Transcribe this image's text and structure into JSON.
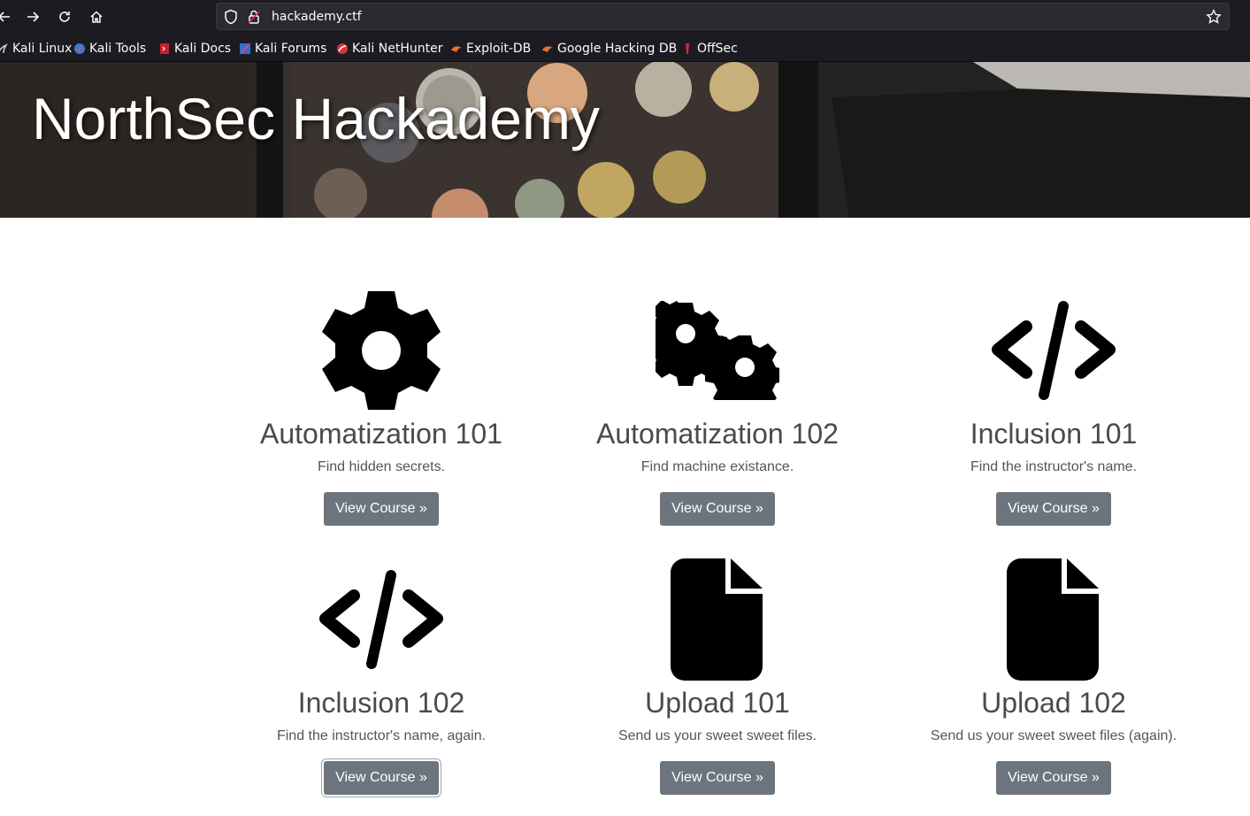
{
  "browser": {
    "url": "hackademy.ctf",
    "bookmarks": [
      {
        "label": "Kali Linux",
        "icon": "kali-dragon-icon"
      },
      {
        "label": "Kali Tools",
        "icon": "kali-tools-icon"
      },
      {
        "label": "Kali Docs",
        "icon": "kali-docs-icon"
      },
      {
        "label": "Kali Forums",
        "icon": "kali-forums-icon"
      },
      {
        "label": "Kali NetHunter",
        "icon": "nethunter-icon"
      },
      {
        "label": "Exploit-DB",
        "icon": "exploit-db-icon"
      },
      {
        "label": "Google Hacking DB",
        "icon": "ghdb-icon"
      },
      {
        "label": "OffSec",
        "icon": "offsec-icon"
      }
    ]
  },
  "hero": {
    "title": "NorthSec Hackademy"
  },
  "courses": [
    {
      "title": "Automatization 101",
      "description": "Find hidden secrets.",
      "button": "View Course »",
      "icon": "gear-icon"
    },
    {
      "title": "Automatization 102",
      "description": "Find machine existance.",
      "button": "View Course »",
      "icon": "gears-icon"
    },
    {
      "title": "Inclusion 101",
      "description": "Find the instructor's name.",
      "button": "View Course »",
      "icon": "code-icon"
    },
    {
      "title": "Inclusion 102",
      "description": "Find the instructor's name, again.",
      "button": "View Course »",
      "icon": "code-icon"
    },
    {
      "title": "Upload 101",
      "description": "Send us your sweet sweet files.",
      "button": "View Course »",
      "icon": "file-icon"
    },
    {
      "title": "Upload 102",
      "description": "Send us your sweet sweet files (again).",
      "button": "View Course »",
      "icon": "file-icon"
    }
  ],
  "colors": {
    "button_bg": "#6c757d",
    "chrome_bg": "#1c1b22",
    "heading_text": "#4a4a4a"
  }
}
